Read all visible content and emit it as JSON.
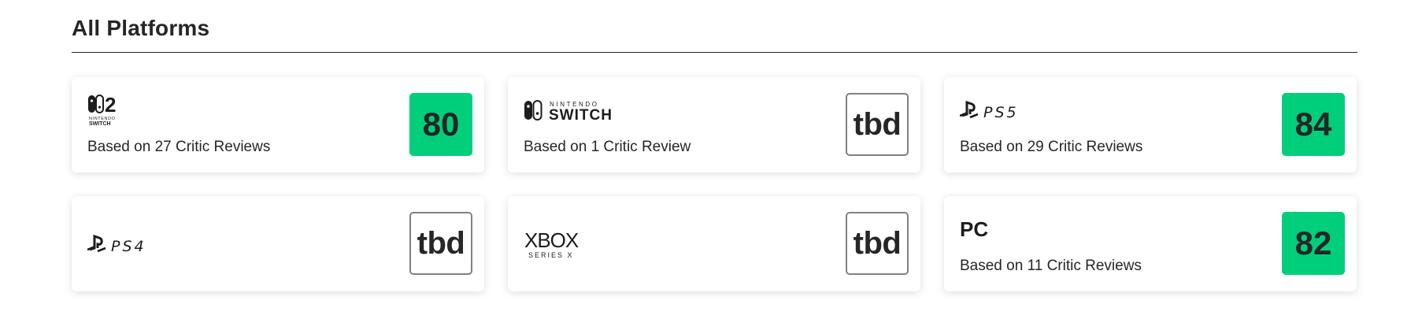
{
  "section": {
    "title": "All Platforms"
  },
  "colors": {
    "score_good": "#00ce7a",
    "tbd_border": "#808080"
  },
  "platforms": [
    {
      "name": "Nintendo Switch 2",
      "logo_icon": "nintendo-switch-2-logo-icon",
      "logo_text_big": "2",
      "logo_text_small": "NINTENDO",
      "logo_text_small2": "SWITCH",
      "reviews": "Based on 27 Critic Reviews",
      "score": "80"
    },
    {
      "name": "Nintendo Switch",
      "logo_icon": "nintendo-switch-logo-icon",
      "logo_text_small": "NINTENDO",
      "logo_text_big": "SWITCH",
      "reviews": "Based on 1 Critic Review",
      "score": "tbd"
    },
    {
      "name": "PS5",
      "logo_icon": "ps5-logo-icon",
      "logo_text": "PS5",
      "reviews": "Based on 29 Critic Reviews",
      "score": "84"
    },
    {
      "name": "PS4",
      "logo_icon": "ps4-logo-icon",
      "logo_text": "PS4",
      "reviews": "",
      "score": "tbd"
    },
    {
      "name": "Xbox Series X",
      "logo_icon": "xbox-series-x-logo-icon",
      "logo_text_big": "XBOX",
      "logo_text_small": "SERIES X",
      "reviews": "",
      "score": "tbd"
    },
    {
      "name": "PC",
      "logo_text": "PC",
      "reviews": "Based on 11 Critic Reviews",
      "score": "82"
    }
  ]
}
